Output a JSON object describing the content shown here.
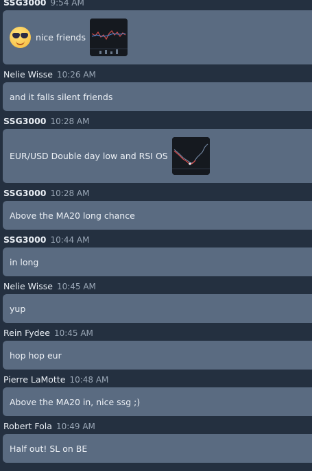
{
  "messages": [
    {
      "author": "SSG3000",
      "bold": true,
      "time": "9:54 AM",
      "text": "nice friends",
      "emoji": "sunglasses-emoji-icon",
      "chart_thumb": true
    },
    {
      "author": "Nelie Wisse",
      "bold": false,
      "time": "10:26 AM",
      "text": "and it falls silent friends"
    },
    {
      "author": "SSG3000",
      "bold": true,
      "time": "10:28 AM",
      "text": "EUR/USD Double day low and RSI OS",
      "chart_thumb": true
    },
    {
      "author": "SSG3000",
      "bold": true,
      "time": "10:28 AM",
      "text": "Above the MA20 long chance"
    },
    {
      "author": "SSG3000",
      "bold": true,
      "time": "10:44 AM",
      "text": "in long"
    },
    {
      "author": "Nelie Wisse",
      "bold": false,
      "time": "10:45 AM",
      "text": "yup"
    },
    {
      "author": "Rein Fydee",
      "bold": false,
      "time": "10:45 AM",
      "text": "hop hop eur"
    },
    {
      "author": "Pierre LaMotte",
      "bold": false,
      "time": "10:48 AM",
      "text": "Above the MA20 in, nice ssg ;)"
    },
    {
      "author": "Robert Fola",
      "bold": false,
      "time": "10:49 AM",
      "text": "Half out! SL on BE"
    }
  ],
  "colors": {
    "background": "#243040",
    "bubble": "#5a6b81",
    "time": "#9aa7b6"
  }
}
